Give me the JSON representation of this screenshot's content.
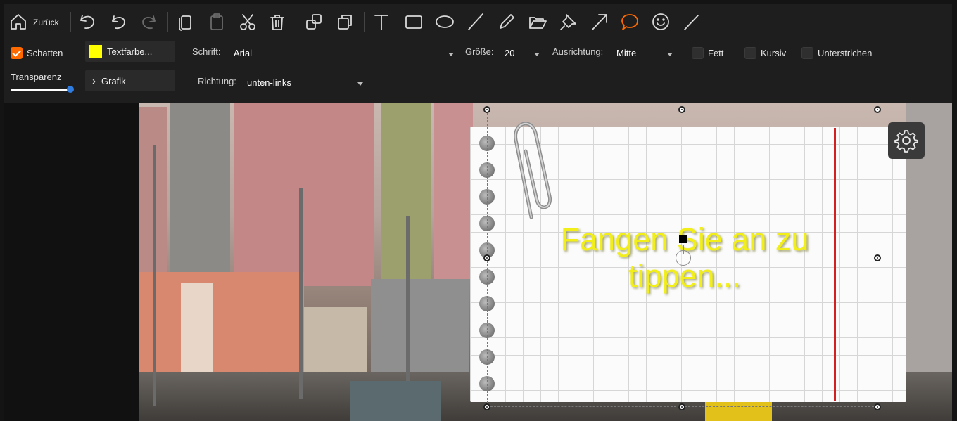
{
  "toolbar": {
    "back_label": "Zurück",
    "accent_color": "#ff6a00"
  },
  "options": {
    "shadow_label": "Schatten",
    "shadow_checked": true,
    "textcolor_label": "Textfarbe...",
    "textcolor_value": "#ffff00",
    "font_label": "Schrift:",
    "font_value": "Arial",
    "size_label": "Größe:",
    "size_value": "20",
    "align_label": "Ausrichtung:",
    "align_value": "Mitte",
    "bold_label": "Fett",
    "italic_label": "Kursiv",
    "underline_label": "Unterstrichen",
    "transparency_label": "Transparenz",
    "graphic_label": "Grafik",
    "direction_label": "Richtung:",
    "direction_value": "unten-links"
  },
  "canvas": {
    "placeholder_line1": "Fangen Sie an zu",
    "placeholder_line2": "tippen...",
    "text_color": "#f2ee19",
    "margin_line_color": "#d22020"
  }
}
